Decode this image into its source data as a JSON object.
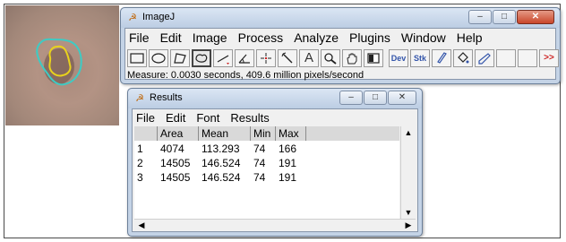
{
  "imagej": {
    "title": "ImageJ",
    "menu": [
      "File",
      "Edit",
      "Image",
      "Process",
      "Analyze",
      "Plugins",
      "Window",
      "Help"
    ],
    "status": "Measure: 0.0030 seconds, 409.6 million pixels/second",
    "tools": [
      {
        "name": "rectangle-tool-icon"
      },
      {
        "name": "oval-tool-icon"
      },
      {
        "name": "polygon-tool-icon"
      },
      {
        "name": "freehand-tool-icon",
        "selected": true
      },
      {
        "name": "line-tool-icon"
      },
      {
        "name": "angle-tool-icon"
      },
      {
        "name": "point-tool-icon"
      },
      {
        "name": "wand-tool-icon"
      },
      {
        "name": "text-tool-icon",
        "label": "A"
      },
      {
        "name": "magnifier-tool-icon"
      },
      {
        "name": "hand-tool-icon"
      },
      {
        "name": "color-picker-tool-icon"
      },
      {
        "name": "developer-menu-icon",
        "label": "Dev"
      },
      {
        "name": "stack-tools-icon",
        "label": "Stk"
      },
      {
        "name": "brush-tool-icon"
      },
      {
        "name": "flood-fill-tool-icon"
      },
      {
        "name": "pencil-tool-icon"
      },
      {
        "name": "more-tools-icon",
        "label": ">>"
      }
    ]
  },
  "results": {
    "title": "Results",
    "menu": [
      "File",
      "Edit",
      "Font",
      "Results"
    ],
    "columns": [
      "",
      "Area",
      "Mean",
      "Min",
      "Max"
    ],
    "rows": [
      [
        "1",
        "4074",
        "113.293",
        "74",
        "166"
      ],
      [
        "2",
        "14505",
        "146.524",
        "74",
        "191"
      ],
      [
        "3",
        "14505",
        "146.524",
        "74",
        "191"
      ]
    ]
  },
  "colors": {
    "outline_inner": "#e8d21c",
    "outline_outer": "#3ecbc4",
    "close_button": "#c9462a"
  }
}
